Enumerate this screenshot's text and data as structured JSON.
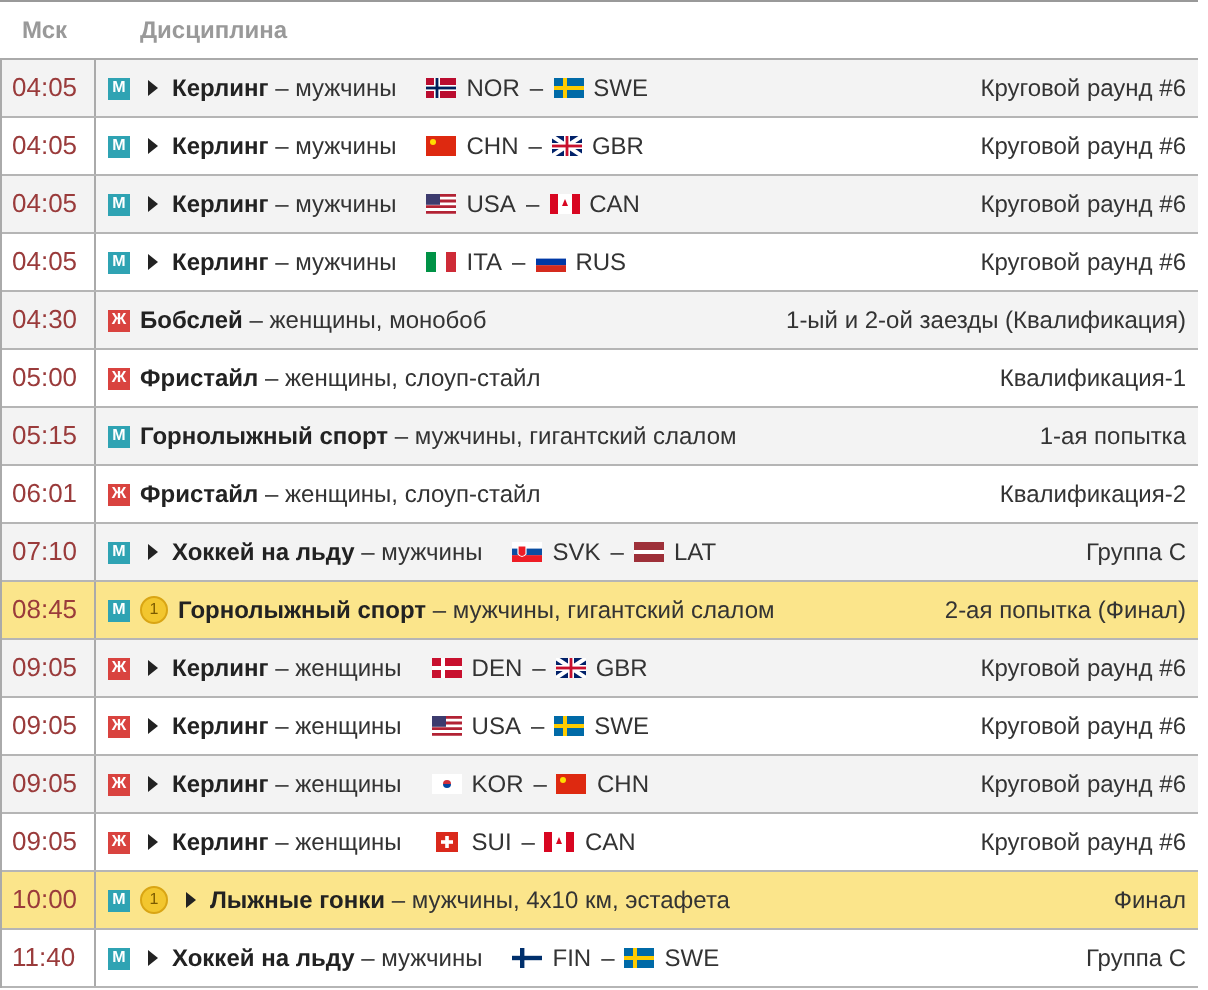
{
  "columns": [
    "Мск",
    "Дисциплина"
  ],
  "rows": [
    {
      "time": "04:05",
      "kind": "m",
      "gender_label": "М",
      "expandable": true,
      "highlight": false,
      "sport": "Керлинг",
      "details": " – мужчины",
      "teams": [
        {
          "kind": "nor",
          "code": "NOR"
        },
        {
          "kind": "swe",
          "code": "SWE"
        }
      ],
      "separator": "–",
      "stage": "Круговой раунд #6"
    },
    {
      "time": "04:05",
      "kind": "m",
      "gender_label": "М",
      "expandable": true,
      "highlight": false,
      "sport": "Керлинг",
      "details": " – мужчины",
      "teams": [
        {
          "kind": "chn",
          "code": "CHN"
        },
        {
          "kind": "gbr",
          "code": "GBR"
        }
      ],
      "separator": "–",
      "stage": "Круговой раунд #6"
    },
    {
      "time": "04:05",
      "kind": "m",
      "gender_label": "М",
      "expandable": true,
      "highlight": false,
      "sport": "Керлинг",
      "details": " – мужчины",
      "teams": [
        {
          "kind": "usa",
          "code": "USA"
        },
        {
          "kind": "can",
          "code": "CAN"
        }
      ],
      "separator": "–",
      "stage": "Круговой раунд #6"
    },
    {
      "time": "04:05",
      "kind": "m",
      "gender_label": "М",
      "expandable": true,
      "highlight": false,
      "sport": "Керлинг",
      "details": " – мужчины",
      "teams": [
        {
          "kind": "ita",
          "code": "ITA"
        },
        {
          "kind": "rus",
          "code": "RUS"
        }
      ],
      "separator": "–",
      "stage": "Круговой раунд #6"
    },
    {
      "time": "04:30",
      "kind": "w",
      "gender_label": "Ж",
      "expandable": false,
      "highlight": false,
      "sport": "Бобслей",
      "details": " – женщины, монобоб",
      "stage": "1-ый и 2-ой заезды (Квалификация)"
    },
    {
      "time": "05:00",
      "kind": "w",
      "gender_label": "Ж",
      "expandable": false,
      "highlight": false,
      "sport": "Фристайл",
      "details": " – женщины, слоуп-стайл",
      "stage": "Квалификация-1"
    },
    {
      "time": "05:15",
      "kind": "m",
      "gender_label": "М",
      "expandable": false,
      "highlight": false,
      "sport": "Горнолыжный спорт",
      "details": " – мужчины, гигантский слалом",
      "stage": "1-ая попытка"
    },
    {
      "time": "06:01",
      "kind": "w",
      "gender_label": "Ж",
      "expandable": false,
      "highlight": false,
      "sport": "Фристайл",
      "details": " – женщины, слоуп-стайл",
      "stage": "Квалификация-2"
    },
    {
      "time": "07:10",
      "kind": "m",
      "gender_label": "М",
      "expandable": true,
      "highlight": false,
      "sport": "Хоккей на льду",
      "details": " – мужчины",
      "teams": [
        {
          "kind": "svk",
          "code": "SVK"
        },
        {
          "kind": "lat",
          "code": "LAT"
        }
      ],
      "separator": "–",
      "stage": "Группа C"
    },
    {
      "time": "08:45",
      "kind": "m",
      "gender_label": "М",
      "expandable": false,
      "highlight": true,
      "medal": "1",
      "sport": "Горнолыжный спорт",
      "details": " – мужчины, гигантский слалом",
      "stage": "2-ая попытка (Финал)"
    },
    {
      "time": "09:05",
      "kind": "w",
      "gender_label": "Ж",
      "expandable": true,
      "highlight": false,
      "sport": "Керлинг",
      "details": " – женщины",
      "teams": [
        {
          "kind": "den",
          "code": "DEN"
        },
        {
          "kind": "gbr",
          "code": "GBR"
        }
      ],
      "separator": "–",
      "stage": "Круговой раунд #6"
    },
    {
      "time": "09:05",
      "kind": "w",
      "gender_label": "Ж",
      "expandable": true,
      "highlight": false,
      "sport": "Керлинг",
      "details": " – женщины",
      "teams": [
        {
          "kind": "usa",
          "code": "USA"
        },
        {
          "kind": "swe",
          "code": "SWE"
        }
      ],
      "separator": "–",
      "stage": "Круговой раунд #6"
    },
    {
      "time": "09:05",
      "kind": "w",
      "gender_label": "Ж",
      "expandable": true,
      "highlight": false,
      "sport": "Керлинг",
      "details": " – женщины",
      "teams": [
        {
          "kind": "kor",
          "code": "KOR"
        },
        {
          "kind": "chn",
          "code": "CHN"
        }
      ],
      "separator": "–",
      "stage": "Круговой раунд #6"
    },
    {
      "time": "09:05",
      "kind": "w",
      "gender_label": "Ж",
      "expandable": true,
      "highlight": false,
      "sport": "Керлинг",
      "details": " – женщины",
      "teams": [
        {
          "kind": "sui",
          "code": "SUI"
        },
        {
          "kind": "can",
          "code": "CAN"
        }
      ],
      "separator": "–",
      "stage": "Круговой раунд #6"
    },
    {
      "time": "10:00",
      "kind": "m",
      "gender_label": "М",
      "expandable": true,
      "highlight": true,
      "medal": "1",
      "sport": "Лыжные гонки",
      "details": " – мужчины, 4x10 км, эстафета",
      "stage": "Финал"
    },
    {
      "time": "11:40",
      "kind": "m",
      "gender_label": "М",
      "expandable": true,
      "highlight": false,
      "sport": "Хоккей на льду",
      "details": " – мужчины",
      "teams": [
        {
          "kind": "fin",
          "code": "FIN"
        },
        {
          "kind": "swe",
          "code": "SWE"
        }
      ],
      "separator": "–",
      "stage": "Группа C"
    }
  ]
}
